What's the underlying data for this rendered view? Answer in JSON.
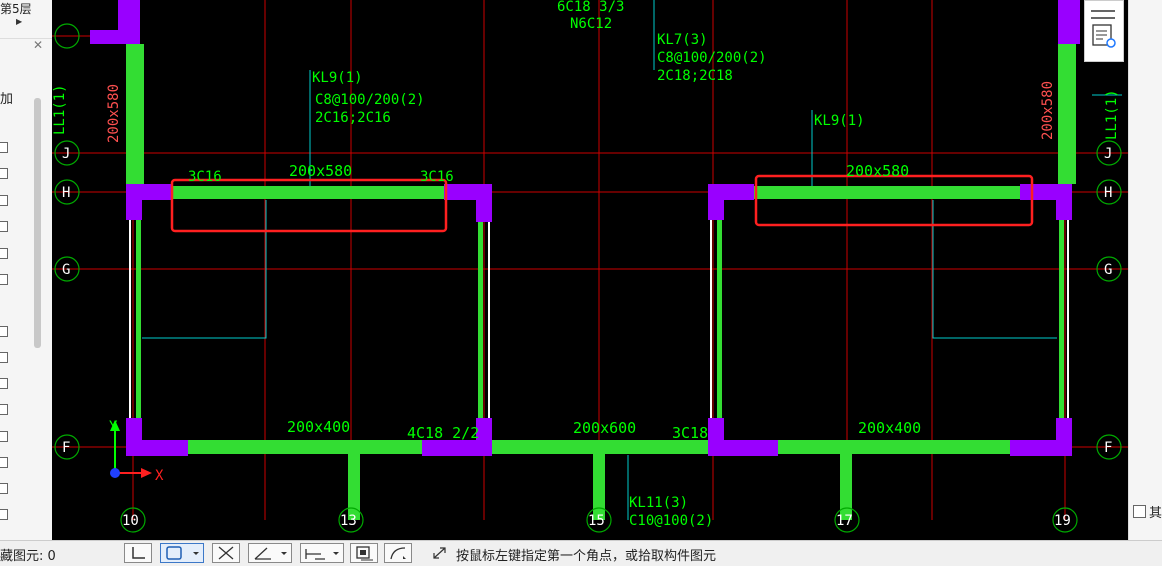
{
  "left_panel": {
    "floor_label": "第5层",
    "add_label": "加",
    "checkbox_count": 15
  },
  "cad": {
    "grid_rows": [
      {
        "label": "J",
        "side": "both"
      },
      {
        "label": "H",
        "side": "both"
      },
      {
        "label": "G",
        "side": "both"
      },
      {
        "label": "F",
        "side": "both"
      }
    ],
    "grid_cols": [
      "10",
      "13",
      "15",
      "17",
      "19"
    ],
    "annotations": {
      "top_center_1": "6C18 3/3",
      "top_center_2": "N6C12",
      "kl7_name": "KL7(3)",
      "kl7_stirrup": "C8@100/200(2)",
      "kl7_bars": "2C18;2C18",
      "kl9_left_name": "KL9(1)",
      "kl9_left_stirrup": "C8@100/200(2)",
      "kl9_left_bars": "2C16;2C16",
      "kl9_right_name": "KL9(1)",
      "left_top_bar": "3C16",
      "right_top_bar": "3C16",
      "size_left_top": "200x580",
      "size_right_top": "200x580",
      "size_bottom_left": "200x400",
      "size_bottom_mid": "200x600",
      "size_bottom_right": "200x400",
      "bottom_bars_left": "4C18 2/2",
      "bottom_bars_mid": "3C18",
      "vertical_size_left": "200x580",
      "vertical_size_right": "200x580",
      "ll_left": "LL1(1)",
      "ll_right": "LL1(1)",
      "kl11_name": "KL11(3)",
      "kl11_stirrup": "C10@100(2)",
      "axis_x": "X",
      "axis_y": "Y"
    },
    "colors": {
      "background": "#000000",
      "grid": "#cc0000",
      "beam": "#33dd33",
      "column": "#9900ff",
      "highlight": "#ff2020",
      "leader": "#00cccc"
    }
  },
  "right_panel": {
    "cut_label": "其"
  },
  "status_bar": {
    "hidden_count": "藏图元: 0",
    "hint": "按鼠标左键指定第一个角点，或拾取构件图元"
  }
}
